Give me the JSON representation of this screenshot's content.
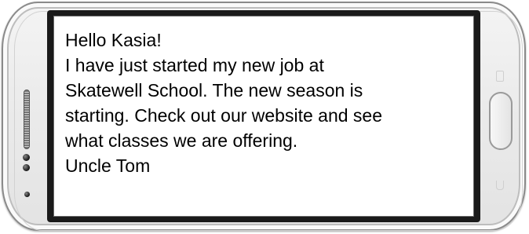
{
  "message": {
    "lines": [
      "Hello Kasia!",
      "I have just started my new job at",
      "Skatewell School. The new season is",
      "starting. Check out our website and see",
      "what classes we are offering.",
      "Uncle Tom"
    ]
  },
  "colors": {
    "phone_body": "#ebebeb",
    "bezel": "#1a1a1a",
    "screen": "#ffffff",
    "text": "#000000"
  },
  "icons": [
    "volume-key",
    "front-camera",
    "proximity-sensor",
    "earpiece",
    "menu-key-icon",
    "home-button",
    "back-key-icon"
  ]
}
